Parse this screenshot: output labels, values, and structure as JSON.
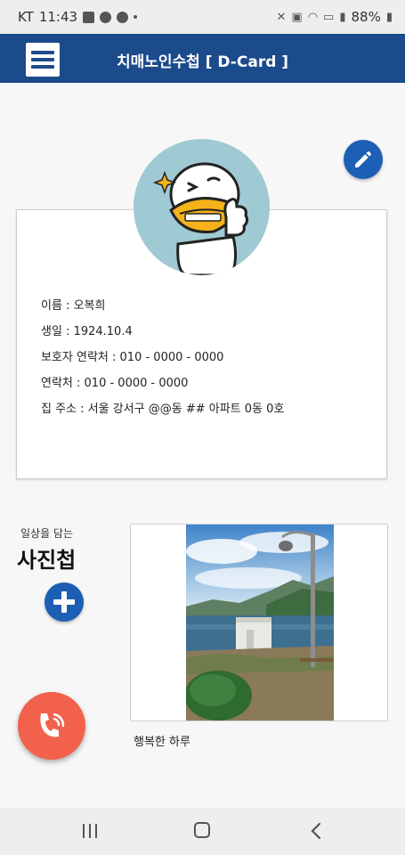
{
  "status_bar": {
    "carrier": "KT",
    "time": "11:43",
    "battery": "88%"
  },
  "app_bar": {
    "title": "치매노인수첩 [ D-Card ]"
  },
  "profile": {
    "name_line": "이름 : 오복희",
    "birth_line": "생일 : 1924.10.4",
    "guardian_line": "보호자 연락처 : 010 - 0000 - 0000",
    "contact_line": "연락처 : 010 - 0000 - 0000",
    "address_line": "집 주소 : 서울 강서구 @@동 ## 아파트 0동 0호"
  },
  "album": {
    "subtitle": "일상을 담는",
    "title": "사진첩",
    "photo_caption": "행복한 하루"
  },
  "colors": {
    "app_bar": "#1c4b8c",
    "fab_blue": "#1c5fb4",
    "call_fab": "#f2614b",
    "avatar_bg": "#9fc9d3"
  },
  "icons": {
    "menu": "hamburger-menu-icon",
    "edit": "pencil-icon",
    "add": "plus-icon",
    "call": "phone-call-icon"
  }
}
